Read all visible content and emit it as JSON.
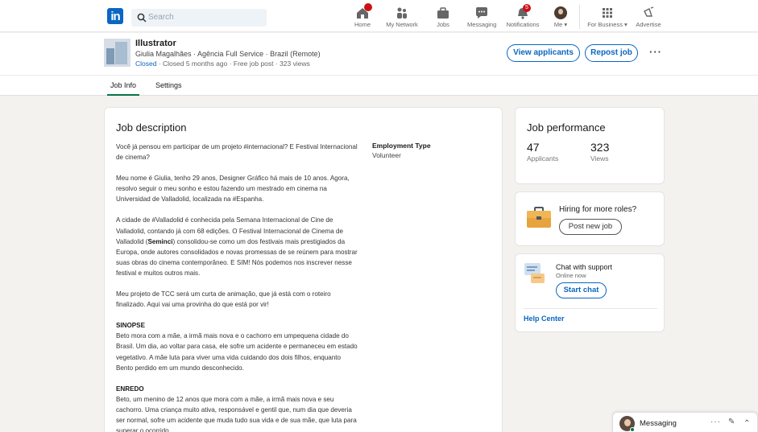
{
  "nav": {
    "logo": "in",
    "search_placeholder": "Search",
    "items": [
      {
        "label": "Home",
        "icon": "home-icon"
      },
      {
        "label": "My Network",
        "icon": "network-icon"
      },
      {
        "label": "Jobs",
        "icon": "briefcase-icon"
      },
      {
        "label": "Messaging",
        "icon": "chat-bubble-icon"
      },
      {
        "label": "Notifications",
        "icon": "bell-icon",
        "badge": "5"
      },
      {
        "label": "Me ▾",
        "icon": "avatar"
      },
      {
        "label": "For Business ▾",
        "icon": "grid-icon"
      },
      {
        "label": "Advertise",
        "icon": "megaphone-icon"
      }
    ]
  },
  "job": {
    "title": "Illustrator",
    "subtitle": "Giulia Magalhães · Agência Full Service · Brazil (Remote)",
    "status_closed": "Closed",
    "status_rest": " · Closed 5 months ago · Free job post · 323 views",
    "view_applicants": "View applicants",
    "repost": "Repost job",
    "more": "···"
  },
  "tabs": [
    {
      "label": "Job Info",
      "active": true
    },
    {
      "label": "Settings",
      "active": false
    }
  ],
  "description": {
    "heading": "Job description",
    "paragraphs": [
      "Você já pensou em participar de um projeto #internacional? E Festival Internacional de cinema?",
      "Meu nome é Giulia, tenho 29 anos, Designer Gráfico há mais de 10 anos. Agora, resolvo seguir o meu sonho e estou fazendo um mestrado em cinema na Universidad de Valladolid, localizada na #Espanha.",
      "A cidade de #Valladolid é conhecida pela Semana Internacional de Cine de Valladolid, contando já com 68 edições. O Festival Internacional de Cinema de Valladolid (",
      "Meu projeto de TCC será um curta de animação, que já está com o roteiro finalizado. Aqui vai uma provinha do que está por vir!"
    ],
    "seminci_bold": "Seminci",
    "paragraph3_rest": ") consolidou-se como um dos festivais mais prestigiados da Europa, onde autores consolidados e novas promessas de se reúnem para mostrar suas obras do cinema contemporâneo. E SIM! Nós podemos nos inscrever nesse festival e muitos outros mais.",
    "sinopse_title": "SINOPSE",
    "sinopse_text": "Beto mora com a mãe, a irmã mais nova e o cachorro em umpequena cidade do Brasil. Um dia, ao voltar para casa, ele sofre um acidente e permaneceu em estado vegetativo. A mãe luta para viver uma vida cuidando dos dois filhos, enquanto Bento perdido em um mundo desconhecido.",
    "enredo_title": "ENREDO",
    "enredo_text": "Beto, um menino de 12 anos que mora com a mãe, a irmã mais nova e seu cachorro. Uma criança muito ativa, responsável e gentil que, num dia que deveria ser normal, sofre um acidente que muda tudo sua vida e de sua mãe, que luta para superar o ocorrido.",
    "employment_label": "Employment Type",
    "employment_value": "Volunteer"
  },
  "performance": {
    "heading": "Job performance",
    "applicants_value": "47",
    "applicants_label": "Applicants",
    "views_value": "323",
    "views_label": "Views"
  },
  "hiring": {
    "text": "Hiring for more roles?",
    "button": "Post new job"
  },
  "support": {
    "title": "Chat with support",
    "status": "Online now",
    "button": "Start chat",
    "help": "Help Center"
  },
  "messaging": {
    "label": "Messaging",
    "more": "···",
    "compose": "✎",
    "collapse": "⌃"
  },
  "colors": {
    "brand": "#0a66c2",
    "active_tab": "#057642",
    "notification_badge": "#cc1016"
  }
}
